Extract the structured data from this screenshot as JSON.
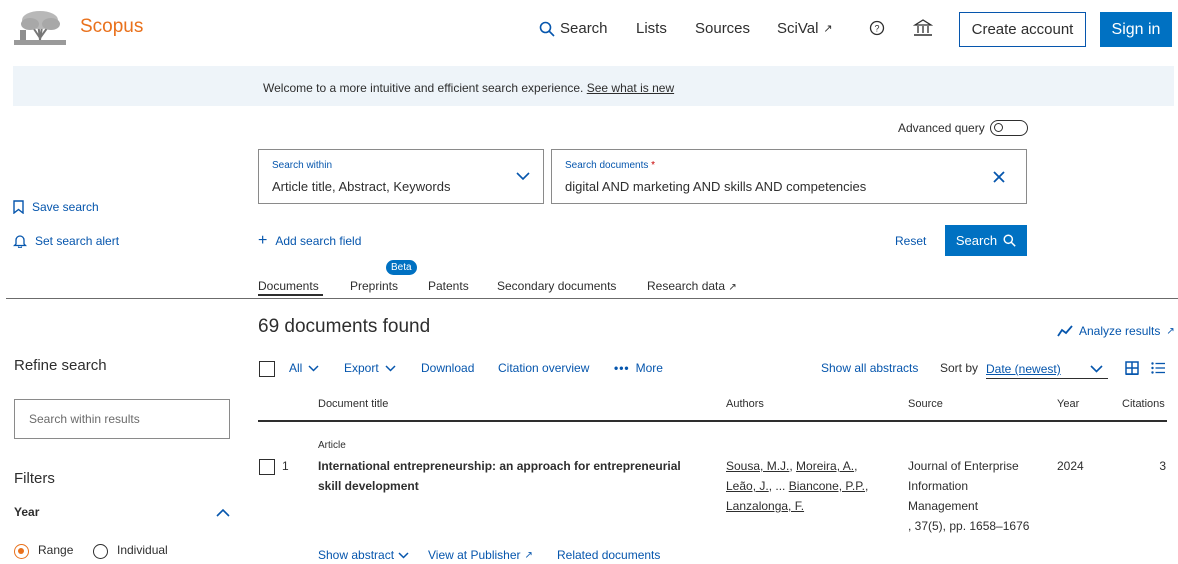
{
  "header": {
    "brand": "Scopus",
    "nav": {
      "search": "Search",
      "lists": "Lists",
      "sources": "Sources",
      "scival": "SciVal"
    },
    "create_account": "Create account",
    "sign_in": "Sign in"
  },
  "banner": {
    "text": "Welcome to a more intuitive and efficient search experience.",
    "link": "See what is new"
  },
  "advanced_query": {
    "label": "Advanced query",
    "enabled": false
  },
  "search_within": {
    "label": "Search within",
    "value": "Article title, Abstract, Keywords"
  },
  "search_documents": {
    "label": "Search documents",
    "required_mark": "*",
    "value": "digital AND marketing AND skills AND competencies"
  },
  "sidebar": {
    "save_search": "Save search",
    "set_alert": "Set search alert",
    "refine": "Refine search",
    "within_placeholder": "Search within results",
    "filters": "Filters",
    "year": "Year",
    "range": "Range",
    "individual": "Individual",
    "selected_year_mode": "Range"
  },
  "search_actions": {
    "add_field": "Add search field",
    "reset": "Reset",
    "search": "Search"
  },
  "tabs": {
    "documents": "Documents",
    "preprints": "Preprints",
    "beta": "Beta",
    "patents": "Patents",
    "secondary": "Secondary documents",
    "research_data": "Research data",
    "active": "Documents"
  },
  "results": {
    "count": "69 documents found",
    "analyze": "Analyze results"
  },
  "toolbar": {
    "all": "All",
    "export": "Export",
    "download": "Download",
    "citation_overview": "Citation overview",
    "more": "More",
    "show_abstracts": "Show all abstracts",
    "sort_by": "Sort by",
    "sort_value": "Date (newest)"
  },
  "table": {
    "columns": [
      "Document title",
      "Authors",
      "Source",
      "Year",
      "Citations"
    ],
    "rows": [
      {
        "index": "1",
        "type": "Article",
        "title_line1": "International entrepreneurship: an approach for entrepreneurial",
        "title_line2": "skill development",
        "authors": {
          "line1_a": "Sousa, M.J.",
          "line1_sep": ",",
          "line1_b": "Moreira, A.",
          "line2_a": "Leão, J.",
          "line2_mid": ", ...",
          "line2_b": "Biancone, P.P.",
          "line3": "Lanzalonga, F."
        },
        "source": [
          "Journal of Enterprise",
          "Information",
          "Management",
          ", 37(5), pp. 1658–1676"
        ],
        "year": "2024",
        "citations": "3",
        "show_abstract": "Show abstract",
        "view_publisher": "View at Publisher",
        "related": "Related documents"
      }
    ]
  },
  "colors": {
    "accent": "#0071c2",
    "link": "#0656ad",
    "brand": "#e9711c",
    "banner_bg": "#eef4f9"
  }
}
